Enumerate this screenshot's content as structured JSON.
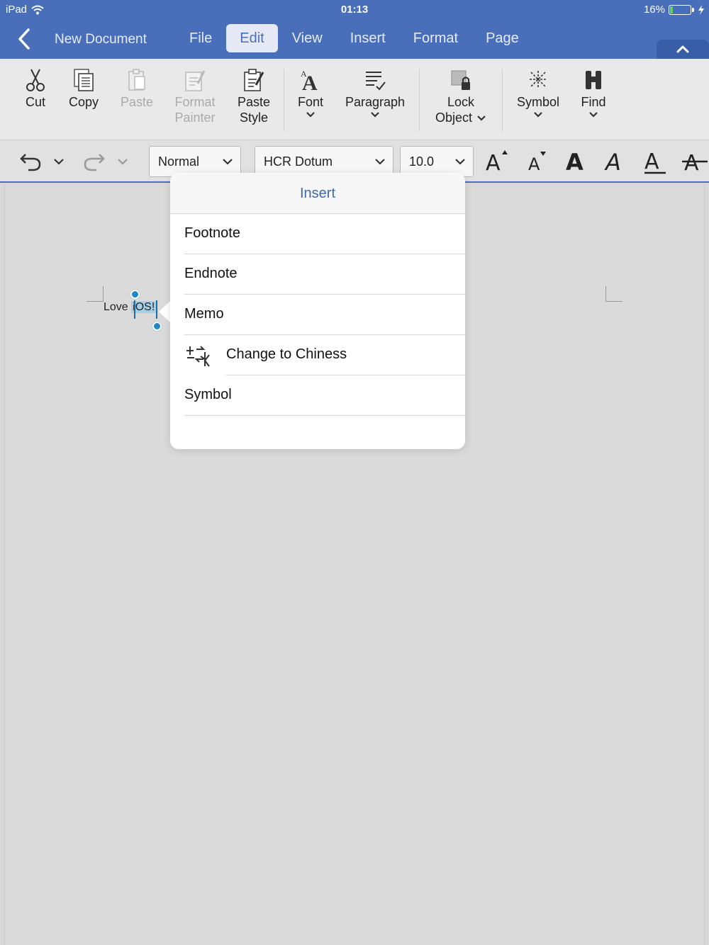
{
  "status": {
    "device": "iPad",
    "time": "01:13",
    "battery": "16%",
    "battery_level": 0.16,
    "charging": true
  },
  "header": {
    "doc_title": "New Document",
    "tabs": [
      {
        "label": "File",
        "active": false
      },
      {
        "label": "Edit",
        "active": true
      },
      {
        "label": "View",
        "active": false
      },
      {
        "label": "Insert",
        "active": false
      },
      {
        "label": "Format",
        "active": false
      },
      {
        "label": "Page",
        "active": false
      }
    ]
  },
  "ribbon": {
    "cut": "Cut",
    "copy": "Copy",
    "paste": "Paste",
    "format_painter_1": "Format",
    "format_painter_2": "Painter",
    "paste_style_1": "Paste",
    "paste_style_2": "Style",
    "font": "Font",
    "paragraph": "Paragraph",
    "lock_object_1": "Lock",
    "lock_object_2": "Object",
    "symbol": "Symbol",
    "find": "Find"
  },
  "formatbar": {
    "style": "Normal",
    "font": "HCR Dotum",
    "size": "10.0"
  },
  "document": {
    "text_before": "Love ",
    "text_selected": "iOS!"
  },
  "popover": {
    "title": "Insert",
    "items": [
      "Footnote",
      "Endnote",
      "Memo",
      "Change to Chiness",
      "Symbol"
    ]
  },
  "colors": {
    "accent": "#4a6fba",
    "popover_title": "#3f67ab",
    "selection": "#a6cfe6"
  }
}
